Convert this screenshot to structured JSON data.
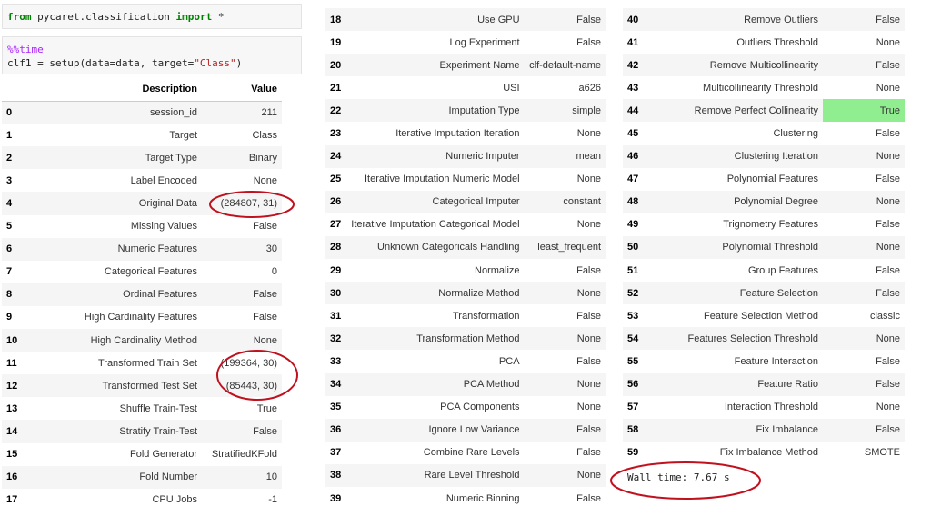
{
  "cell1": {
    "kw_from": "from",
    "module": " pycaret.classification ",
    "kw_import": "import",
    "star": " *"
  },
  "cell2": {
    "magic": "%%time",
    "line2_pre": "clf1 = setup(data=data, target=",
    "line2_str": "\"Class\"",
    "line2_post": ")"
  },
  "table_headers": {
    "description": "Description",
    "value": "Value"
  },
  "col1": [
    {
      "idx": "0",
      "desc": "session_id",
      "val": "211"
    },
    {
      "idx": "1",
      "desc": "Target",
      "val": "Class"
    },
    {
      "idx": "2",
      "desc": "Target Type",
      "val": "Binary"
    },
    {
      "idx": "3",
      "desc": "Label Encoded",
      "val": "None"
    },
    {
      "idx": "4",
      "desc": "Original Data",
      "val": "(284807, 31)"
    },
    {
      "idx": "5",
      "desc": "Missing Values",
      "val": "False"
    },
    {
      "idx": "6",
      "desc": "Numeric Features",
      "val": "30"
    },
    {
      "idx": "7",
      "desc": "Categorical Features",
      "val": "0"
    },
    {
      "idx": "8",
      "desc": "Ordinal Features",
      "val": "False"
    },
    {
      "idx": "9",
      "desc": "High Cardinality Features",
      "val": "False"
    },
    {
      "idx": "10",
      "desc": "High Cardinality Method",
      "val": "None"
    },
    {
      "idx": "11",
      "desc": "Transformed Train Set",
      "val": "(199364, 30)"
    },
    {
      "idx": "12",
      "desc": "Transformed Test Set",
      "val": "(85443, 30)"
    },
    {
      "idx": "13",
      "desc": "Shuffle Train-Test",
      "val": "True"
    },
    {
      "idx": "14",
      "desc": "Stratify Train-Test",
      "val": "False"
    },
    {
      "idx": "15",
      "desc": "Fold Generator",
      "val": "StratifiedKFold"
    },
    {
      "idx": "16",
      "desc": "Fold Number",
      "val": "10"
    },
    {
      "idx": "17",
      "desc": "CPU Jobs",
      "val": "-1"
    }
  ],
  "col2": [
    {
      "idx": "18",
      "desc": "Use GPU",
      "val": "False"
    },
    {
      "idx": "19",
      "desc": "Log Experiment",
      "val": "False"
    },
    {
      "idx": "20",
      "desc": "Experiment Name",
      "val": "clf-default-name"
    },
    {
      "idx": "21",
      "desc": "USI",
      "val": "a626"
    },
    {
      "idx": "22",
      "desc": "Imputation Type",
      "val": "simple"
    },
    {
      "idx": "23",
      "desc": "Iterative Imputation Iteration",
      "val": "None"
    },
    {
      "idx": "24",
      "desc": "Numeric Imputer",
      "val": "mean"
    },
    {
      "idx": "25",
      "desc": "Iterative Imputation Numeric Model",
      "val": "None"
    },
    {
      "idx": "26",
      "desc": "Categorical Imputer",
      "val": "constant"
    },
    {
      "idx": "27",
      "desc": "Iterative Imputation Categorical Model",
      "val": "None"
    },
    {
      "idx": "28",
      "desc": "Unknown Categoricals Handling",
      "val": "least_frequent"
    },
    {
      "idx": "29",
      "desc": "Normalize",
      "val": "False"
    },
    {
      "idx": "30",
      "desc": "Normalize Method",
      "val": "None"
    },
    {
      "idx": "31",
      "desc": "Transformation",
      "val": "False"
    },
    {
      "idx": "32",
      "desc": "Transformation Method",
      "val": "None"
    },
    {
      "idx": "33",
      "desc": "PCA",
      "val": "False"
    },
    {
      "idx": "34",
      "desc": "PCA Method",
      "val": "None"
    },
    {
      "idx": "35",
      "desc": "PCA Components",
      "val": "None"
    },
    {
      "idx": "36",
      "desc": "Ignore Low Variance",
      "val": "False"
    },
    {
      "idx": "37",
      "desc": "Combine Rare Levels",
      "val": "False"
    },
    {
      "idx": "38",
      "desc": "Rare Level Threshold",
      "val": "None"
    },
    {
      "idx": "39",
      "desc": "Numeric Binning",
      "val": "False"
    }
  ],
  "col3": [
    {
      "idx": "40",
      "desc": "Remove Outliers",
      "val": "False"
    },
    {
      "idx": "41",
      "desc": "Outliers Threshold",
      "val": "None"
    },
    {
      "idx": "42",
      "desc": "Remove Multicollinearity",
      "val": "False"
    },
    {
      "idx": "43",
      "desc": "Multicollinearity Threshold",
      "val": "None"
    },
    {
      "idx": "44",
      "desc": "Remove Perfect Collinearity",
      "val": "True",
      "highlight": true
    },
    {
      "idx": "45",
      "desc": "Clustering",
      "val": "False"
    },
    {
      "idx": "46",
      "desc": "Clustering Iteration",
      "val": "None"
    },
    {
      "idx": "47",
      "desc": "Polynomial Features",
      "val": "False"
    },
    {
      "idx": "48",
      "desc": "Polynomial Degree",
      "val": "None"
    },
    {
      "idx": "49",
      "desc": "Trignometry Features",
      "val": "False"
    },
    {
      "idx": "50",
      "desc": "Polynomial Threshold",
      "val": "None"
    },
    {
      "idx": "51",
      "desc": "Group Features",
      "val": "False"
    },
    {
      "idx": "52",
      "desc": "Feature Selection",
      "val": "False"
    },
    {
      "idx": "53",
      "desc": "Feature Selection Method",
      "val": "classic"
    },
    {
      "idx": "54",
      "desc": "Features Selection Threshold",
      "val": "None"
    },
    {
      "idx": "55",
      "desc": "Feature Interaction",
      "val": "False"
    },
    {
      "idx": "56",
      "desc": "Feature Ratio",
      "val": "False"
    },
    {
      "idx": "57",
      "desc": "Interaction Threshold",
      "val": "None"
    },
    {
      "idx": "58",
      "desc": "Fix Imbalance",
      "val": "False"
    },
    {
      "idx": "59",
      "desc": "Fix Imbalance Method",
      "val": "SMOTE"
    }
  ],
  "wall_time": "Wall time: 7.67 s",
  "colors": {
    "highlight": "#90ee90",
    "annotation": "#c0111f",
    "keyword": "#008000",
    "string": "#ba2121",
    "magic": "#aa22ff"
  }
}
